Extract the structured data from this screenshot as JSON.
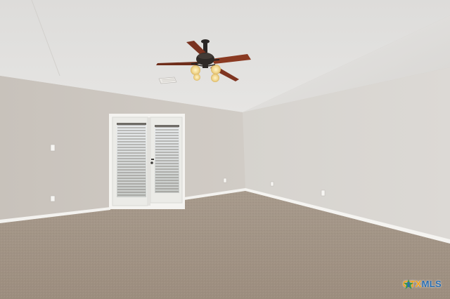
{
  "scene": {
    "description_type": "photo-interior",
    "elements": [
      "vaulted-ceiling",
      "ceiling-fan-with-lights",
      "french-doors",
      "carpet-floor",
      "baseboards",
      "light-switch",
      "outlets",
      "air-vent"
    ]
  },
  "watermark": {
    "part1": "CTX",
    "part2": "MLS"
  },
  "colors": {
    "wall_left": "#cdc8c1",
    "wall_right": "#d8d5d0",
    "ceiling": "#e2e1df",
    "carpet": "#a39586",
    "trim": "#f4f3f0",
    "fan_blade": "#8a3a22",
    "watermark_ctx": "#f2a31b",
    "watermark_mls": "#2a6fb3"
  }
}
